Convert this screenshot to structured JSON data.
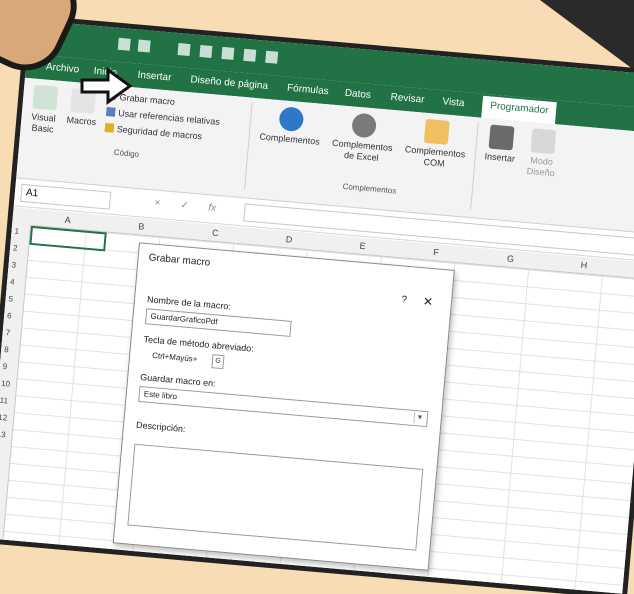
{
  "tabs": [
    "Archivo",
    "Inicio",
    "Insertar",
    "Diseño de página",
    "Fórmulas",
    "Datos",
    "Revisar",
    "Vista",
    "Programador"
  ],
  "ribbon": {
    "visual_basic": "Visual Basic",
    "macros": "Macros",
    "grabar_macro": "Grabar macro",
    "usar_referencias": "Usar referencias relativas",
    "seguridad": "Seguridad de macros",
    "grupo_codigo": "Código",
    "complementos": "Complementos",
    "complementos_excel": "Complementos de Excel",
    "complementos_com": "Complementos COM",
    "grupo_complementos": "Complementos",
    "insertar": "Insertar",
    "modo_diseno": "Modo Diseño"
  },
  "formula_bar": {
    "name_box": "A1",
    "cancel": "×",
    "enter": "✓",
    "fx": "fx"
  },
  "columns": [
    "A",
    "B",
    "C",
    "D",
    "E",
    "F",
    "G",
    "H"
  ],
  "rows": [
    "1",
    "2",
    "3",
    "4",
    "5",
    "6",
    "7",
    "8",
    "9",
    "10",
    "11",
    "12",
    "13"
  ],
  "dialog": {
    "title": "Grabar macro",
    "help": "?",
    "close": "✕",
    "name_label": "Nombre de la macro:",
    "name_value": "GuardarGraficoPdf",
    "shortcut_label": "Tecla de método abreviado:",
    "shortcut_prefix": "Ctrl+Mayús+",
    "shortcut_key": "G",
    "store_label": "Guardar macro en:",
    "store_value": "Este libro",
    "description_label": "Descripción:"
  },
  "colors": {
    "excel_green": "#217346",
    "background": "#f7dcb4"
  }
}
